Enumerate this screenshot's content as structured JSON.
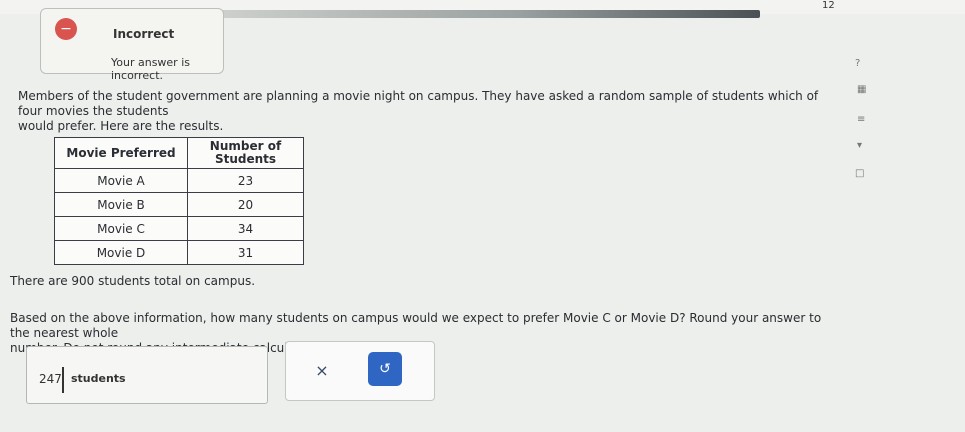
{
  "header": {
    "corner_number": "12"
  },
  "feedback": {
    "icon": "alert-circle-icon",
    "title": "Incorrect",
    "message": "Your answer is incorrect."
  },
  "question": {
    "intro_main": "Members of the student government are planning a movie night on campus. They have asked a random sample of students which of four movies the students",
    "intro_cont": "would prefer. Here are the results.",
    "table": {
      "headers": [
        "Movie Preferred",
        "Number of Students"
      ],
      "rows": [
        {
          "movie": "Movie A",
          "count": "23"
        },
        {
          "movie": "Movie B",
          "count": "20"
        },
        {
          "movie": "Movie C",
          "count": "34"
        },
        {
          "movie": "Movie D",
          "count": "31"
        }
      ]
    },
    "total_prefix": "There are ",
    "total_value": "900",
    "total_suffix": " students total on campus.",
    "prompt_main": "Based on the above information, how many students on campus would we expect to prefer Movie C or Movie D? Round your answer to the nearest whole",
    "prompt_cont": "number. Do not round any intermediate calculations."
  },
  "answer": {
    "value": "247",
    "unit": "students"
  },
  "buttons": {
    "clear": "×",
    "undo": "↺"
  },
  "colors": {
    "incorrect": "#d9534f",
    "primary": "#2f66c4"
  }
}
